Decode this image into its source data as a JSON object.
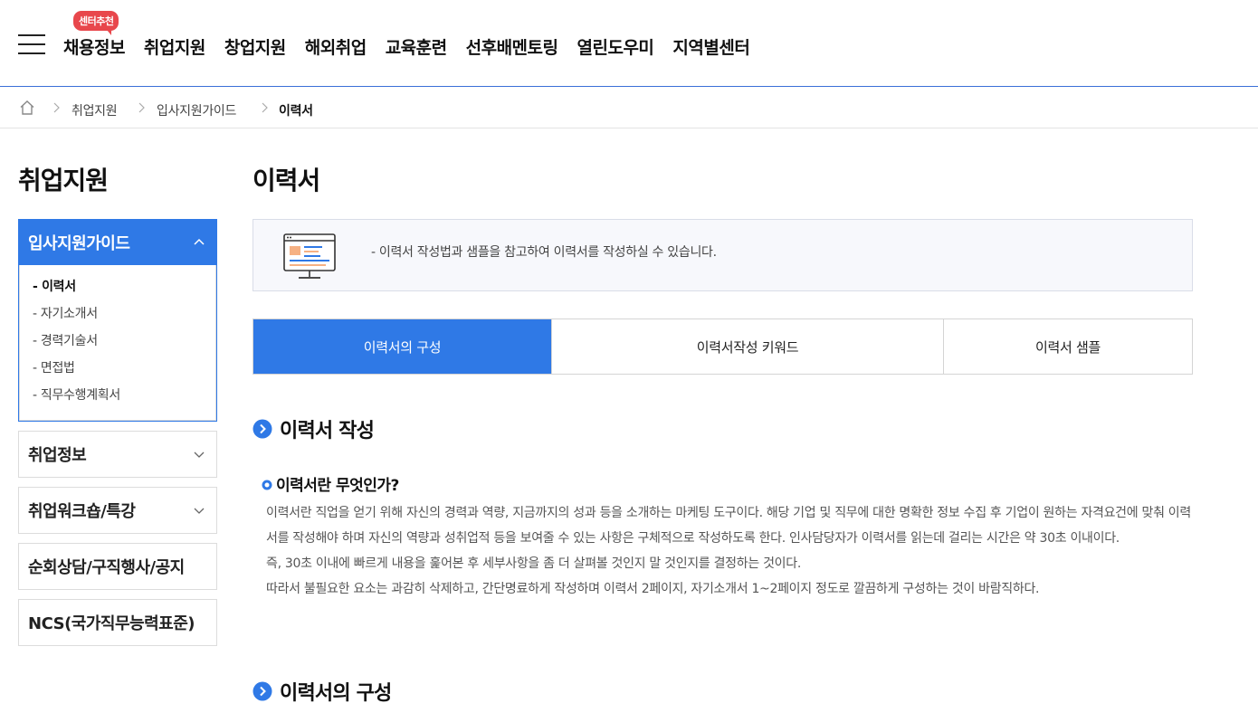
{
  "header": {
    "badge": "센터추천",
    "menu": [
      "채용정보",
      "취업지원",
      "창업지원",
      "해외취업",
      "교육훈련",
      "선후배멘토링",
      "열린도우미",
      "지역별센터"
    ]
  },
  "breadcrumb": {
    "items": [
      "취업지원",
      "입사지원가이드",
      "이력서"
    ]
  },
  "sidebar": {
    "title": "취업지원",
    "active_group": "입사지원가이드",
    "sub_items": [
      "- 이력서",
      "- 자기소개서",
      "- 경력기술서",
      "- 면접법",
      "- 직무수행계획서"
    ],
    "groups": [
      "취업정보",
      "취업워크숍/특강",
      "순회상담/구직행사/공지",
      "NCS(국가직무능력표준)"
    ]
  },
  "main": {
    "title": "이력서",
    "info": "- 이력서 작성법과 샘플을 참고하여 이력서를 작성하실 수 있습니다.",
    "tabs": [
      "이력서의 구성",
      "이력서작성 키워드",
      "이력서 샘플"
    ],
    "section1": "이력서 작성",
    "subtitle": "이력서란 무엇인가?",
    "paragraphs": [
      "이력서란 직업을 얻기 위해 자신의 경력과 역량, 지금까지의 성과 등을 소개하는 마케팅 도구이다. 해당 기업 및 직무에 대한 명확한 정보 수집 후 기업이 원하는 자격요건에 맞춰 이력서를 작성해야 하며 자신의 역량과 성취업적 등을 보여줄 수 있는 사항은 구체적으로 작성하도록 한다. 인사담당자가 이력서를 읽는데 걸리는 시간은 약 30초 이내이다.",
      "즉, 30초 이내에 빠르게 내용을 훑어본 후 세부사항을 좀 더 살펴볼 것인지 말 것인지를 결정하는 것이다.",
      "따라서 불필요한 요소는 과감히 삭제하고, 간단명료하게 작성하며 이력서 2페이지, 자기소개서 1~2페이지 정도로 깔끔하게 구성하는 것이 바람직하다."
    ],
    "section2": "이력서의 구성"
  },
  "colors": {
    "primary": "#2f79e6",
    "badge": "#e8474c",
    "header_line": "#3a6fd8"
  },
  "icons": {
    "menu": "hamburger-icon",
    "home": "home-icon",
    "separator": "chevron-right-icon",
    "collapse": "chevron-up-icon",
    "expand": "chevron-down-icon",
    "info": "monitor-document-icon",
    "section": "circle-arrow-icon",
    "bullet": "circle-bullet-icon"
  }
}
